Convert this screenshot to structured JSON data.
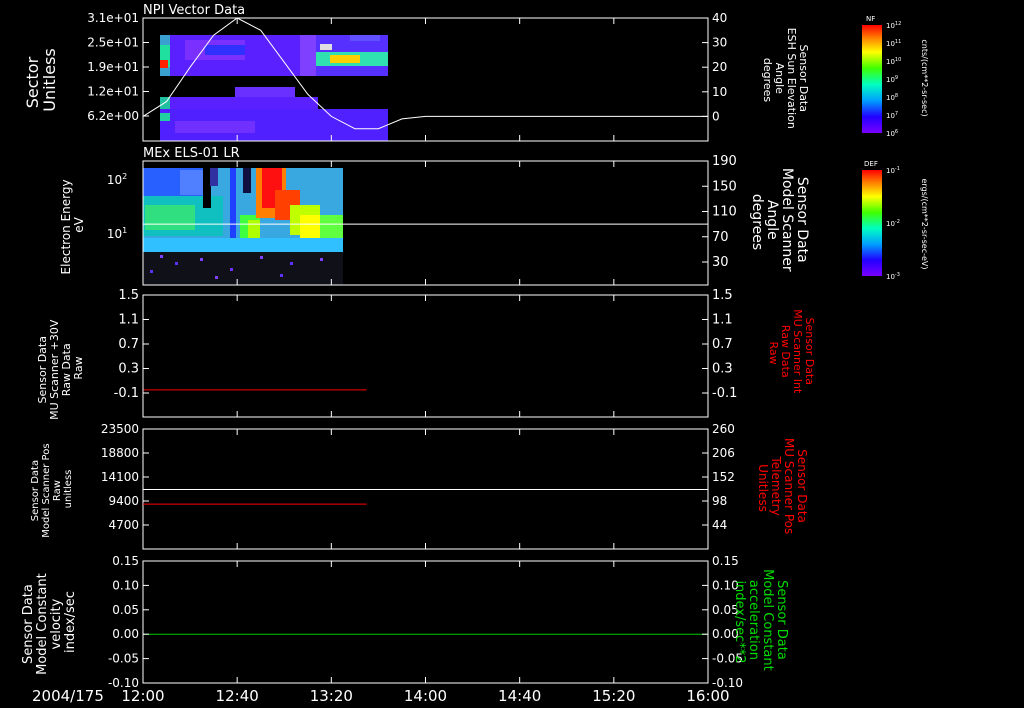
{
  "colors": {
    "background": "#000000",
    "axis": "#ffffff",
    "trace_white": "#ffffff",
    "trace_red": "#ff0000",
    "trace_green": "#00cc00",
    "label_red": "#ff0000",
    "label_green": "#00dd00"
  },
  "footer": {
    "date": "2004/175",
    "time_ticks": [
      "12:00",
      "12:40",
      "13:20",
      "14:00",
      "14:40",
      "15:20",
      "16:00"
    ]
  },
  "chart_data": [
    {
      "type": "heatmap",
      "title": "NPI Vector Data",
      "ylabel_lines": [
        "Sector",
        "Unitless"
      ],
      "yticks": [
        "3.1e+01",
        "2.5e+01",
        "1.9e+01",
        "1.2e+01",
        "6.2e+00"
      ],
      "ylim": [
        0,
        31
      ],
      "y2label_lines": [
        "Sensor Data",
        "ESH Sun Elevation",
        "Angle",
        "degrees"
      ],
      "y2ticks": [
        40,
        30,
        20,
        10,
        0
      ],
      "y2lim": [
        -10,
        40
      ],
      "x_range": [
        "12:00",
        "16:00"
      ],
      "data_extent": [
        "12:00",
        "13:34"
      ],
      "colorbar": {
        "label": "NF",
        "unit": "cnts/(cm**2-sr-sec)",
        "ticks": [
          "10^12",
          "10^11",
          "10^10",
          "10^9",
          "10^8",
          "10^7",
          "10^6"
        ]
      },
      "line_series": {
        "name": "ESH Sun Elevation Angle",
        "color": "#ffffff",
        "x": [
          "12:00",
          "12:10",
          "12:20",
          "12:30",
          "12:40",
          "12:50",
          "13:00",
          "13:10",
          "13:20",
          "13:30",
          "13:40",
          "13:50",
          "14:00",
          "16:00"
        ],
        "y": [
          0,
          6,
          20,
          33,
          40,
          35,
          22,
          9,
          0,
          -5,
          -5,
          -1,
          0,
          0
        ]
      }
    },
    {
      "type": "heatmap",
      "title": "MEx ELS-01 LR",
      "ylabel_lines": [
        "Electron Energy",
        "eV"
      ],
      "yticks": [
        "10^2",
        "10^1"
      ],
      "y2label_lines": [
        "Sensor Data",
        "Model Scanner",
        "Angle",
        "degrees"
      ],
      "y2ticks": [
        190,
        150,
        110,
        70,
        30
      ],
      "x_range": [
        "12:00",
        "16:00"
      ],
      "data_extent": [
        "12:00",
        "13:28"
      ],
      "colorbar": {
        "label": "DEF",
        "unit": "ergs/(cm**2-sr-sec-eV)",
        "ticks": [
          "10^-1",
          "10^-2",
          "10^-3"
        ]
      },
      "line_series": {
        "name": "Model Scanner Angle",
        "color": "#ffffff",
        "x": [
          "12:00",
          "16:00"
        ],
        "y": [
          90,
          90
        ]
      }
    },
    {
      "type": "line",
      "ylabel_lines": [
        "Sensor Data",
        "MU Scanner +30V",
        "Raw Data",
        "Raw"
      ],
      "yticks": [
        "1.5",
        "1.1",
        "0.7",
        "0.3",
        "-0.1"
      ],
      "ylim": [
        -0.5,
        1.5
      ],
      "y2label_lines": [
        "Sensor Data",
        "MU Scanner Int",
        "Raw Data",
        "Raw"
      ],
      "y2ticks": [
        "1.5",
        "1.1",
        "0.7",
        "0.3",
        "-0.1"
      ],
      "series": [
        {
          "color": "#ff0000",
          "x": [
            "12:00",
            "13:35"
          ],
          "y": [
            -0.05,
            -0.05
          ]
        }
      ]
    },
    {
      "type": "line",
      "ylabel_lines": [
        "Sensor Data",
        "Model Scanner Pos",
        "Raw",
        "unitless"
      ],
      "yticks": [
        "23500",
        "18800",
        "14100",
        "9400",
        "4700"
      ],
      "ylim": [
        0,
        23500
      ],
      "y2label_lines": [
        "Sensor Data",
        "MU Scanner Pos",
        "Telemetry",
        "Unitless"
      ],
      "y2ticks": [
        "260",
        "206",
        "152",
        "98",
        "44"
      ],
      "y2lim": [
        -10,
        260
      ],
      "series": [
        {
          "color": "#ffffff",
          "axis": "left",
          "x": [
            "12:00",
            "16:00"
          ],
          "y": [
            11650,
            11650
          ]
        },
        {
          "color": "#ff0000",
          "axis": "right",
          "x": [
            "12:00",
            "13:35"
          ],
          "y": [
            91,
            91
          ]
        }
      ]
    },
    {
      "type": "line",
      "ylabel_lines": [
        "Sensor Data",
        "Model Constant",
        "velocity",
        "index/sec"
      ],
      "yticks": [
        "0.15",
        "0.10",
        "0.05",
        "0.00",
        "-0.05",
        "-0.10"
      ],
      "ylim": [
        -0.1,
        0.15
      ],
      "y2label_lines": [
        "Sensor Data",
        "Model Constant",
        "acceleration",
        "index/sec**2"
      ],
      "y2ticks": [
        "0.15",
        "0.10",
        "0.05",
        "0.00",
        "-0.05",
        "-0.10"
      ],
      "series": [
        {
          "color": "#00cc00",
          "x": [
            "12:00",
            "16:00"
          ],
          "y": [
            0,
            0
          ]
        }
      ]
    }
  ]
}
